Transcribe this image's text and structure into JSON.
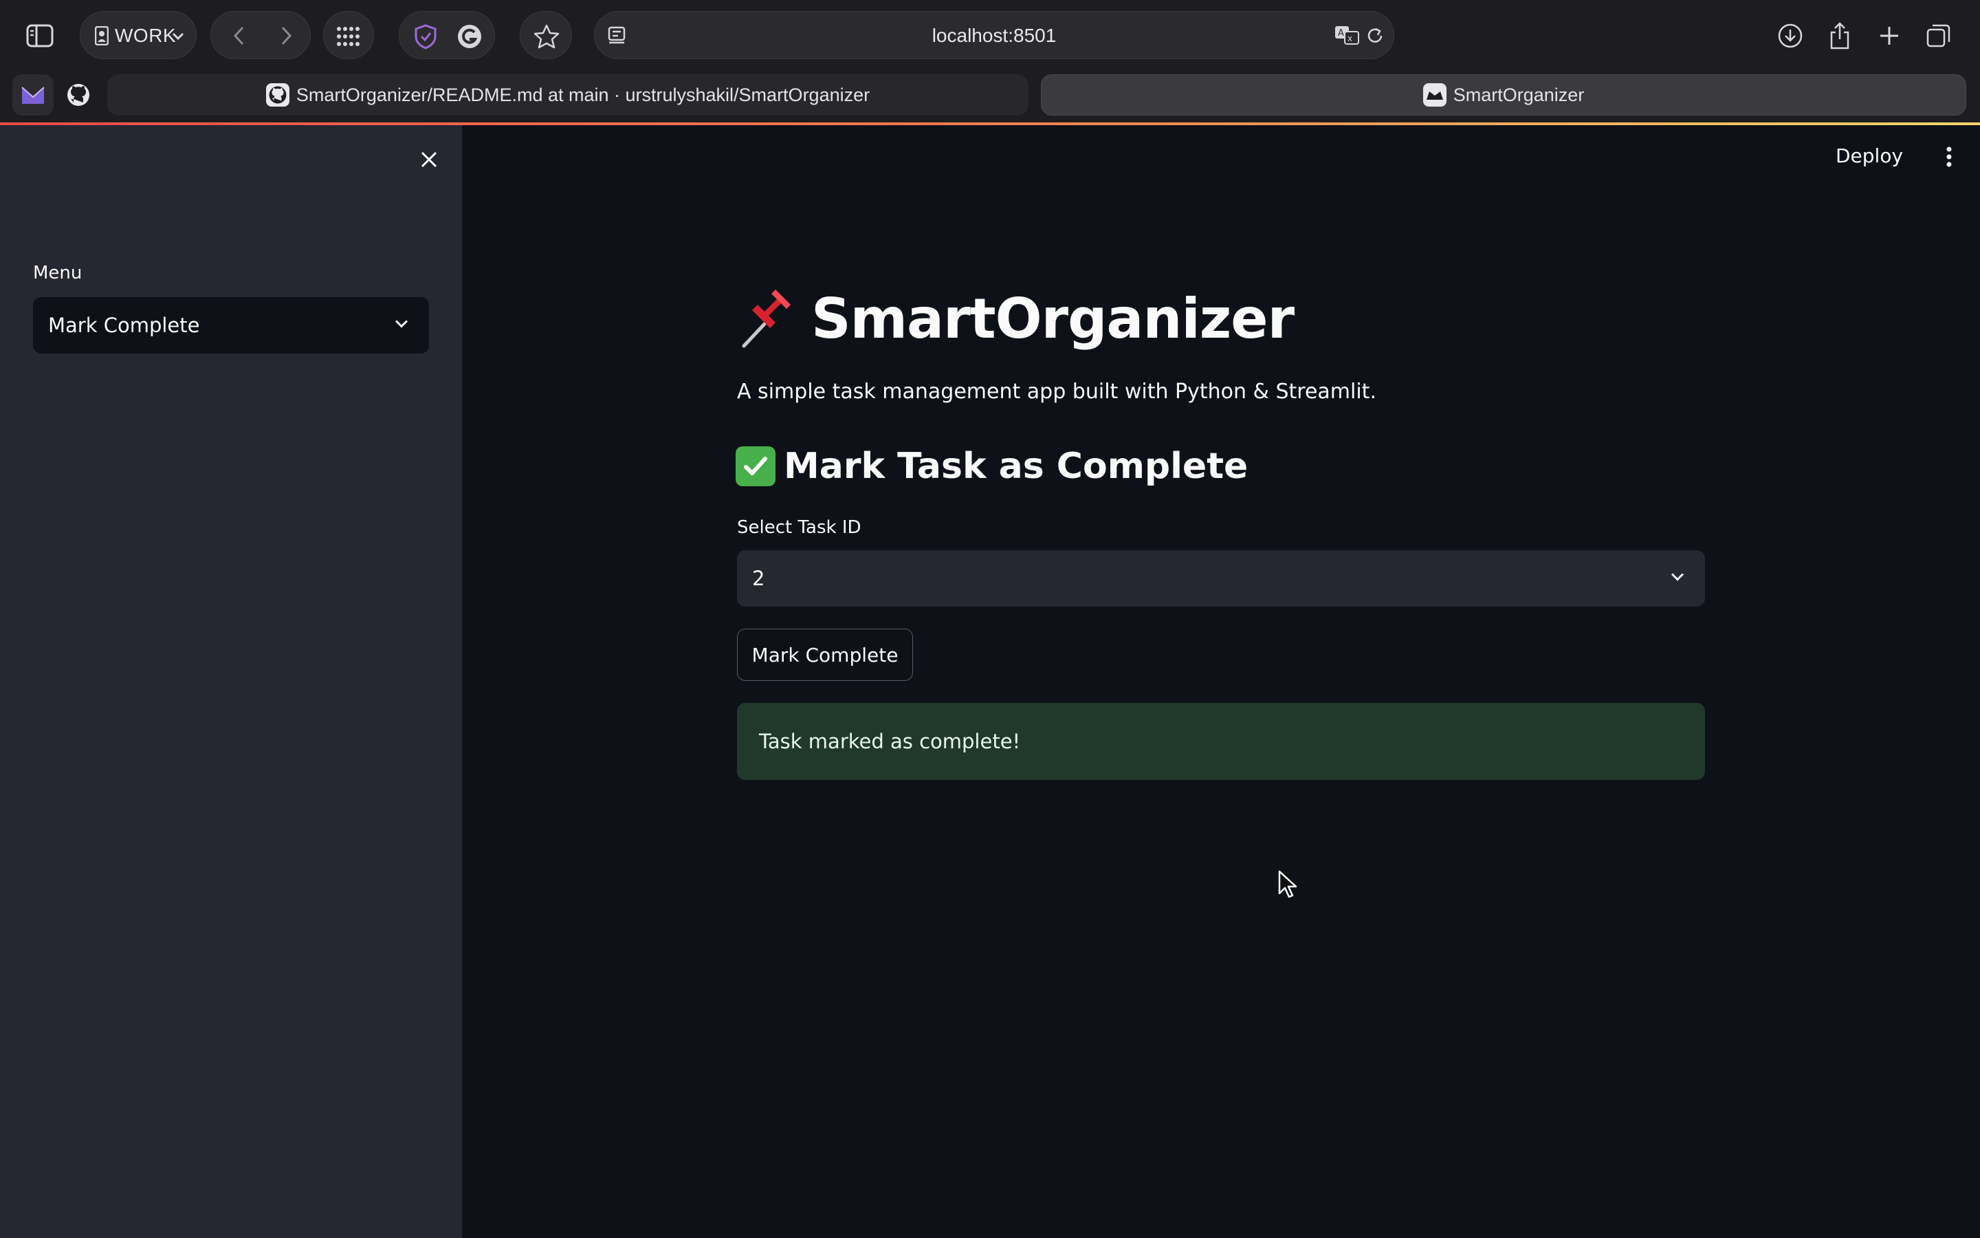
{
  "browser": {
    "profile": "WORK",
    "url": "localhost:8501",
    "tabs": [
      {
        "title": "SmartOrganizer/README.md at main · urstrulyshakil/SmartOrganizer",
        "active": false
      },
      {
        "title": "SmartOrganizer",
        "active": true
      }
    ],
    "pinned": [
      "proton-mail",
      "github"
    ]
  },
  "app": {
    "sidebar": {
      "menu_label": "Menu",
      "menu_selected": "Mark Complete"
    },
    "header": {
      "deploy_label": "Deploy"
    },
    "title_emoji": "pushpin",
    "title": "SmartOrganizer",
    "subtitle": "A simple task management app built with Python & Streamlit.",
    "section_title": "Mark Task as Complete",
    "select_label": "Select Task ID",
    "select_value": "2",
    "button_label": "Mark Complete",
    "success_message": "Task marked as complete!"
  },
  "colors": {
    "background": "#0e1117",
    "sidebar": "#262730",
    "success_bg": "#21392b",
    "check_green": "#47b04b",
    "accent_gradient": [
      "#ff4b4b",
      "#ffd56b"
    ]
  }
}
